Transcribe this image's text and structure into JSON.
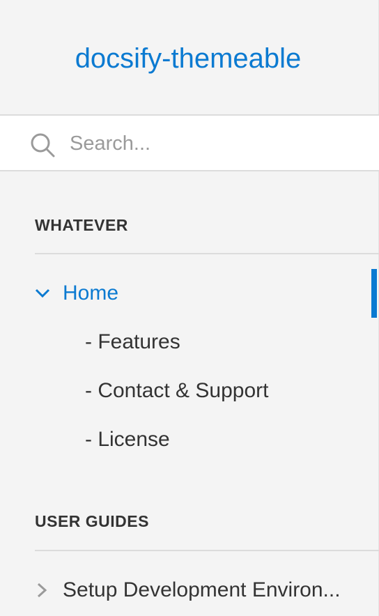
{
  "app": {
    "title": "docsify-themeable"
  },
  "search": {
    "placeholder": "Search..."
  },
  "sections": [
    {
      "heading": "WHATEVER",
      "items": [
        {
          "label": "Home",
          "expanded": true,
          "active": true,
          "children": [
            {
              "label": "- Features"
            },
            {
              "label": "- Contact & Support"
            },
            {
              "label": "- License"
            }
          ]
        }
      ]
    },
    {
      "heading": "USER GUIDES",
      "items": [
        {
          "label": "Setup Development Environ...",
          "expanded": false,
          "active": false
        }
      ]
    }
  ],
  "colors": {
    "accent": "#0b7ad1",
    "background": "#f4f4f4",
    "text": "#333333",
    "muted": "#9a9a9a"
  }
}
